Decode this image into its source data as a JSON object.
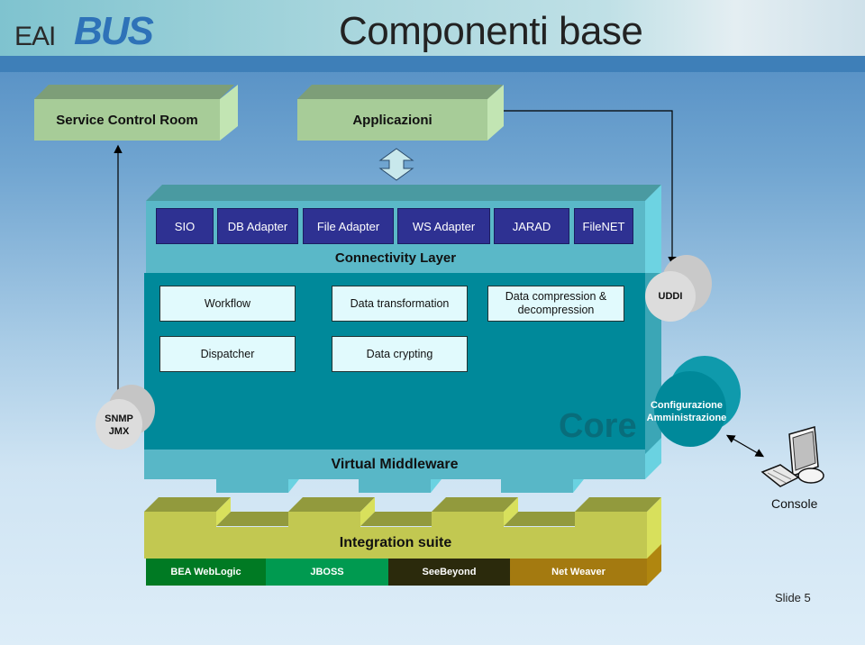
{
  "header": {
    "logo_prefix": "EAI",
    "logo_brand": "BUS",
    "title": "Componenti base"
  },
  "top_boxes": {
    "service_control_room": "Service Control Room",
    "applicazioni": "Applicazioni"
  },
  "connectivity_layer": {
    "label": "Connectivity Layer",
    "adapters": [
      "SIO",
      "DB Adapter",
      "File Adapter",
      "WS Adapter",
      "JARAD",
      "FileNET"
    ]
  },
  "core": {
    "label": "Core",
    "services": {
      "workflow": "Workflow",
      "data_transformation": "Data transformation",
      "data_compression": "Data compression & decompression",
      "dispatcher": "Dispatcher",
      "data_crypting": "Data crypting"
    }
  },
  "cylinders": {
    "uddi": "UDDI",
    "snmp_line1": "SNMP",
    "snmp_line2": "JMX",
    "config_line1": "Configurazione",
    "config_line2": "Amministrazione"
  },
  "virtual_middleware": {
    "label": "Virtual Middleware"
  },
  "integration_suite": {
    "label": "Integration suite",
    "products": [
      {
        "name": "BEA WebLogic",
        "color": "#007a23"
      },
      {
        "name": "JBOSS",
        "color": "#009a50"
      },
      {
        "name": "SeeBeyond",
        "color": "#2b2a0c"
      },
      {
        "name": "Net Weaver",
        "color": "#a47a10"
      }
    ]
  },
  "console": {
    "label": "Console"
  },
  "footer": {
    "slide": "Slide 5"
  }
}
